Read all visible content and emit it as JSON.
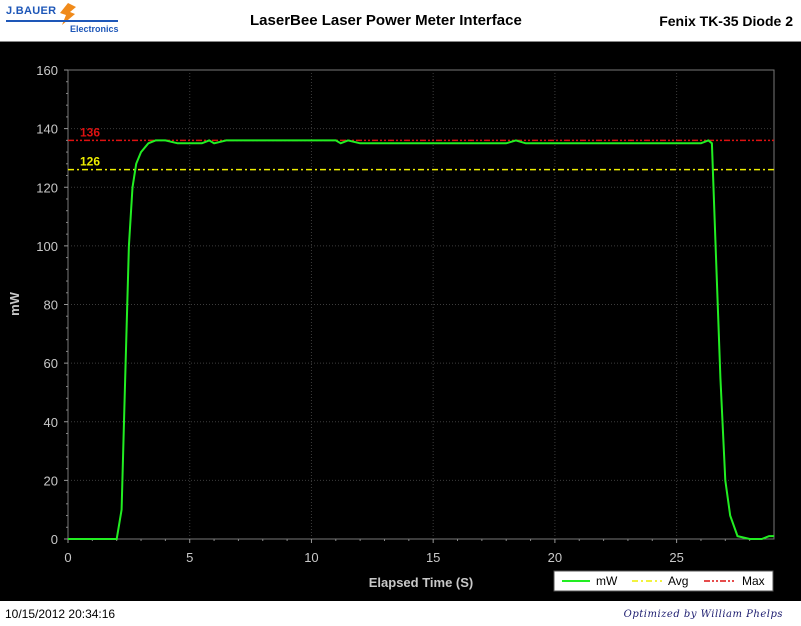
{
  "header": {
    "logo_name": "J.BAUER",
    "logo_sub": "Electronics",
    "title": "LaserBee Laser Power Meter Interface",
    "device": "Fenix TK-35 Diode 2"
  },
  "footer": {
    "timestamp": "10/15/2012 20:34:16",
    "credit": "Optimized by William Phelps"
  },
  "colors": {
    "plot_bg": "#000000",
    "grid": "#3c3c3c",
    "series_mw": "#22ee22",
    "avg_line": "#eeee00",
    "max_line": "#dd1111"
  },
  "chart_data": {
    "type": "line",
    "title": "",
    "xlabel": "Elapsed Time (S)",
    "ylabel": "mW",
    "xlim": [
      0,
      29
    ],
    "ylim": [
      0,
      160
    ],
    "xticks": [
      0,
      5,
      10,
      15,
      20,
      25
    ],
    "yticks": [
      0,
      20,
      40,
      60,
      80,
      100,
      120,
      140,
      160
    ],
    "grid": true,
    "legend": "bottom-right",
    "series": [
      {
        "name": "mW",
        "style": "solid",
        "x": [
          0,
          2.0,
          2.2,
          2.35,
          2.5,
          2.65,
          2.8,
          3.0,
          3.3,
          3.6,
          4.0,
          4.5,
          5.0,
          5.5,
          5.8,
          6.0,
          6.5,
          8,
          10,
          11,
          11.2,
          11.5,
          12,
          15,
          18,
          18.4,
          18.8,
          19.5,
          20,
          23,
          25,
          26,
          26.3,
          26.45,
          26.6,
          26.8,
          27.0,
          27.2,
          27.5,
          28.0,
          28.5,
          28.8,
          29
        ],
        "y": [
          0,
          0,
          10,
          55,
          100,
          120,
          128,
          132,
          135,
          136,
          136,
          135,
          135,
          135,
          136,
          135,
          136,
          136,
          136,
          136,
          135,
          136,
          135,
          135,
          135,
          136,
          135,
          135,
          135,
          135,
          135,
          135,
          136,
          135,
          100,
          55,
          20,
          8,
          1,
          0,
          0,
          1,
          1
        ]
      },
      {
        "name": "Avg",
        "style": "dash-dot",
        "value": 126,
        "label": "126"
      },
      {
        "name": "Max",
        "style": "dash-dot-dot",
        "value": 136,
        "label": "136"
      }
    ]
  }
}
